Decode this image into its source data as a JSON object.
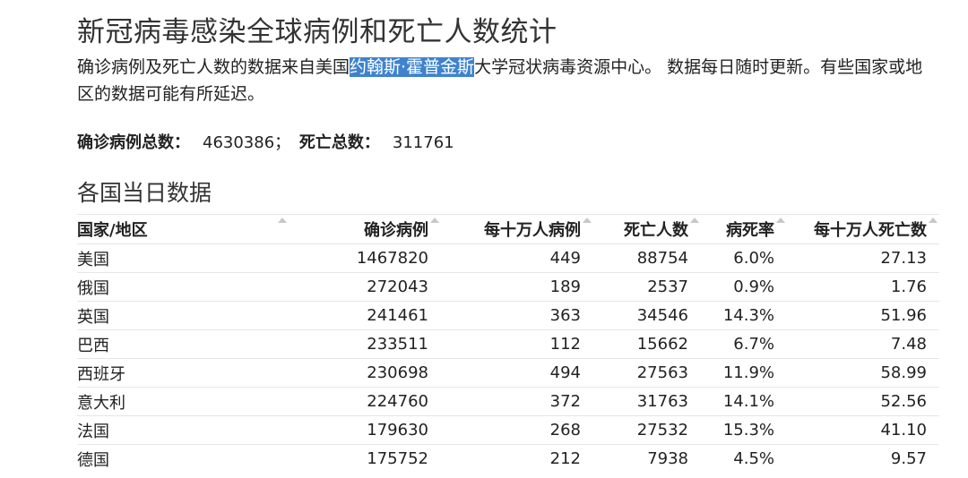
{
  "title": "新冠病毒感染全球病例和死亡人数统计",
  "description": {
    "before": "确诊病例及死亡人数的数据来自美国",
    "highlight": "约翰斯·霍普金斯",
    "after": "大学冠状病毒资源中心。 数据每日随时更新。有些国家或地区的数据可能有所延迟。"
  },
  "totals": {
    "cases_label": "确诊病例总数",
    "cases_value": "4630386；",
    "deaths_label": "死亡总数",
    "deaths_value": "311761"
  },
  "section_title": "各国当日数据",
  "table": {
    "headers": [
      "国家/地区",
      "确诊病例",
      "每十万人病例",
      "死亡人数",
      "病死率",
      "每十万人死亡数"
    ],
    "rows": [
      [
        "美国",
        "1467820",
        "449",
        "88754",
        "6.0%",
        "27.13"
      ],
      [
        "俄国",
        "272043",
        "189",
        "2537",
        "0.9%",
        "1.76"
      ],
      [
        "英国",
        "241461",
        "363",
        "34546",
        "14.3%",
        "51.96"
      ],
      [
        "巴西",
        "233511",
        "112",
        "15662",
        "6.7%",
        "7.48"
      ],
      [
        "西班牙",
        "230698",
        "494",
        "27563",
        "11.9%",
        "58.99"
      ],
      [
        "意大利",
        "224760",
        "372",
        "31763",
        "14.1%",
        "52.56"
      ],
      [
        "法国",
        "179630",
        "268",
        "27532",
        "15.3%",
        "41.10"
      ],
      [
        "德国",
        "175752",
        "212",
        "7938",
        "4.5%",
        "9.57"
      ]
    ]
  }
}
